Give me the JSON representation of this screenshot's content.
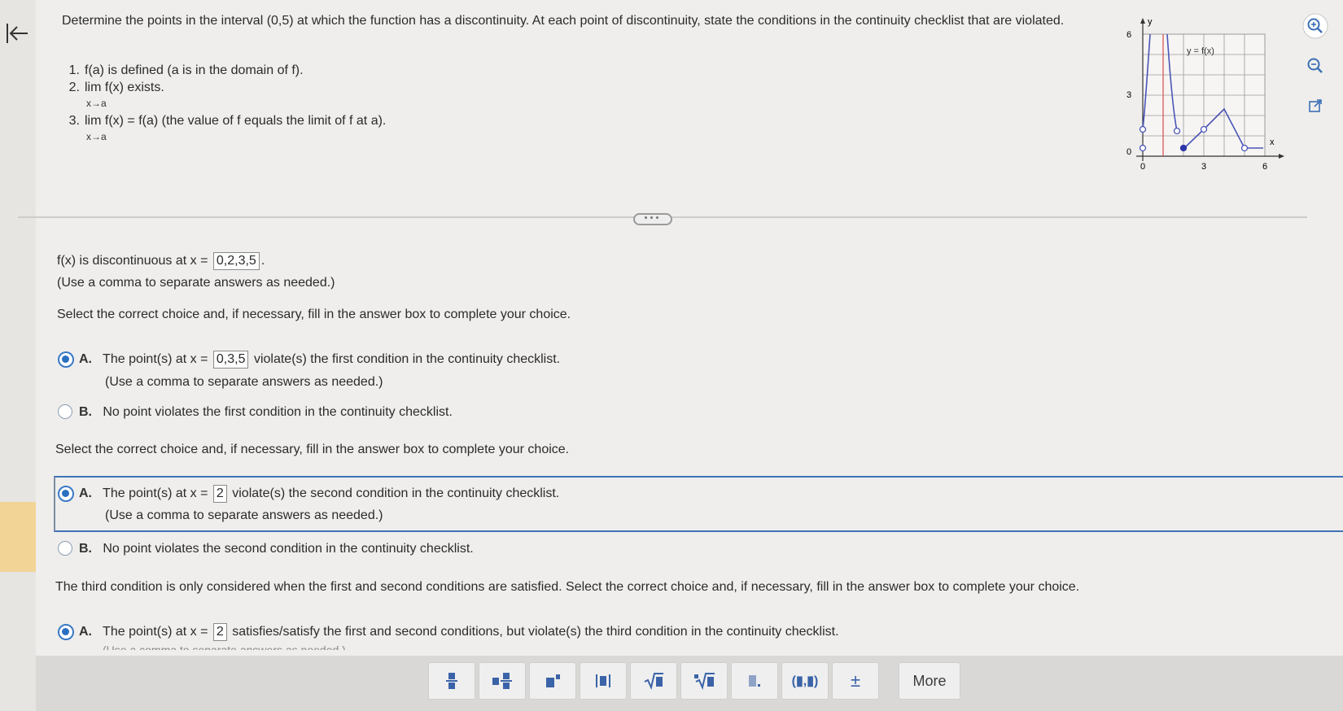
{
  "problem": {
    "text": "Determine the points in the interval (0,5) at which the function has a discontinuity. At each point of discontinuity, state the conditions in the continuity checklist that are violated.",
    "checklist": [
      {
        "num": "1.",
        "text": "f(a) is defined (a is in the domain of f)."
      },
      {
        "num": "2.",
        "text": "lim  f(x) exists.",
        "sub": "x→a"
      },
      {
        "num": "3.",
        "text": "lim  f(x) = f(a) (the value of f equals the limit of f at a).",
        "sub": "x→a"
      }
    ]
  },
  "graph": {
    "y_axis_label": "y",
    "x_axis_label": "x",
    "curve_label": "y = f(x)",
    "y_ticks": [
      "6",
      "3",
      "0"
    ],
    "x_ticks": [
      "0",
      "3",
      "6"
    ]
  },
  "q1": {
    "prefix": "f(x) is discontinuous at x =",
    "answer": "0,2,3,5",
    "suffix": ".",
    "note": "(Use a comma to separate answers as needed.)"
  },
  "instruction": "Select the correct choice and, if necessary, fill in the answer box to complete your choice.",
  "part1": {
    "a_letter": "A.",
    "a_prefix": "The point(s) at x =",
    "a_answer": "0,3,5",
    "a_suffix": "violate(s) the first condition in the continuity checklist.",
    "a_note": "(Use a comma to separate answers as needed.)",
    "b_letter": "B.",
    "b_text": "No point violates the first condition in the continuity checklist."
  },
  "part2": {
    "a_letter": "A.",
    "a_prefix": "The point(s) at x =",
    "a_answer": "2",
    "a_suffix": "violate(s) the second condition in the continuity checklist.",
    "a_note": "(Use a comma to separate answers as needed.)",
    "b_letter": "B.",
    "b_text": "No point violates the second condition in the continuity checklist."
  },
  "part3": {
    "intro": "The third condition is only considered when the first and second conditions are satisfied. Select the correct choice and, if necessary, fill in the answer box to complete your choice.",
    "a_letter": "A.",
    "a_prefix": "The point(s) at x =",
    "a_answer": "2",
    "a_suffix": "satisfies/satisfy the first and second conditions, but violate(s) the third condition in the continuity checklist.",
    "cut_note": "(Use a comma to separate answers as needed.)"
  },
  "toolbar": {
    "buttons": [
      "fraction-icon",
      "mixed-number-icon",
      "exponent-icon",
      "absolute-value-icon",
      "square-root-icon",
      "nth-root-icon",
      "decimal-icon",
      "ordered-pair-icon",
      "plus-minus-icon"
    ],
    "plus_minus": "±",
    "ordered_pair": "(▮,▮)",
    "more_label": "More"
  }
}
